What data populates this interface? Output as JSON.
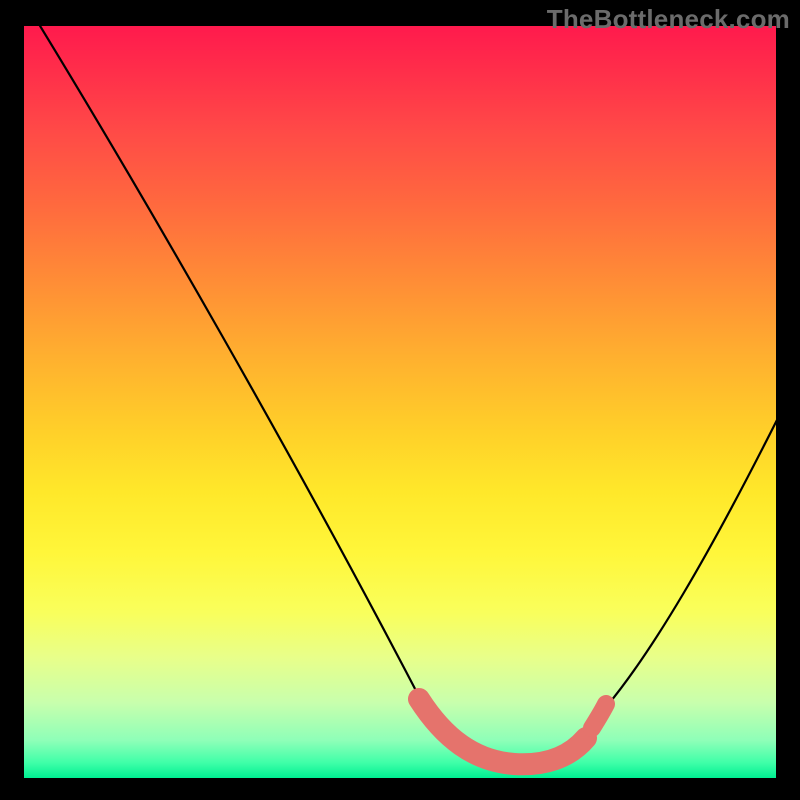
{
  "watermark": "TheBottleneck.com",
  "colors": {
    "frame": "#000000",
    "curve": "#000000",
    "marker": "#e5736c",
    "gradient_top": "#ff1a4d",
    "gradient_bottom": "#00ef92"
  },
  "chart_data": {
    "type": "line",
    "title": "",
    "xlabel": "",
    "ylabel": "",
    "xlim": [
      0,
      100
    ],
    "ylim": [
      0,
      100
    ],
    "grid": false,
    "legend": false,
    "note": "Axes unlabeled in source; values are percent estimates of the plot box. y increases upward (0 at bottom, 100 at top of gradient area).",
    "series": [
      {
        "name": "curve",
        "x": [
          0,
          6,
          12,
          18,
          24,
          30,
          36,
          42,
          48,
          53,
          56,
          60,
          64,
          68,
          72,
          75,
          79,
          84,
          89,
          94,
          100
        ],
        "y": [
          100,
          92,
          83,
          74,
          65,
          56,
          47,
          38,
          28,
          18,
          11,
          6,
          3,
          2,
          2.5,
          4,
          8,
          15,
          25,
          36,
          50
        ]
      }
    ],
    "highlight_segment": {
      "name": "trough-marker",
      "x": [
        53,
        56,
        60,
        64,
        68,
        72,
        75
      ],
      "y": [
        9,
        5,
        3,
        2,
        2,
        3,
        5
      ]
    }
  }
}
